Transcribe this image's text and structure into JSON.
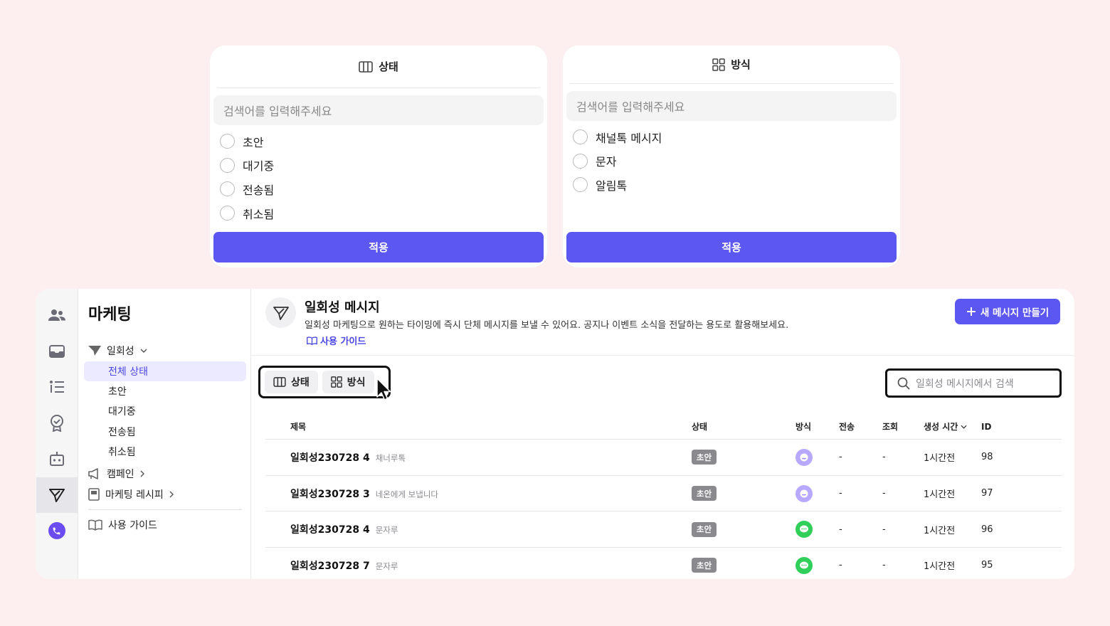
{
  "popover_status": {
    "title": "상태",
    "search_placeholder": "검색어를 입력해주세요",
    "options": [
      "초안",
      "대기중",
      "전송됨",
      "취소됨"
    ],
    "apply_label": "적용"
  },
  "popover_method": {
    "title": "방식",
    "search_placeholder": "검색어를 입력해주세요",
    "options": [
      "채널톡 메시지",
      "문자",
      "알림톡"
    ],
    "apply_label": "적용"
  },
  "sidenav": {
    "title": "마케팅",
    "group_onetime": "일회성",
    "items": [
      "전체 상태",
      "초안",
      "대기중",
      "전송됨",
      "취소됨"
    ],
    "campaign": "캠페인",
    "recipe": "마케팅 레시피",
    "guide": "사용 가이드"
  },
  "header": {
    "title": "일회성 메시지",
    "description": "일회성 마케팅으로 원하는 타이밍에 즉시 단체 메시지를 보낼 수 있어요. 공지나 이벤트 소식을 전달하는 용도로 활용해보세요.",
    "guide_link": "사용 가이드",
    "new_button": "새 메시지 만들기"
  },
  "filters": {
    "status": "상태",
    "method": "방식"
  },
  "search": {
    "placeholder": "일회성 메시지에서 검색"
  },
  "table": {
    "columns": {
      "title": "제목",
      "status": "상태",
      "method": "방식",
      "sent": "전송",
      "view": "조회",
      "created": "생성 시간",
      "id": "ID"
    },
    "rows": [
      {
        "title": "일회성230728 4",
        "sub": "채너루톡",
        "status": "초안",
        "method": "channel",
        "sent": "-",
        "view": "-",
        "created": "1시간전",
        "id": "98"
      },
      {
        "title": "일회성230728 3",
        "sub": "네온에게 보냅니다",
        "status": "초안",
        "method": "channel",
        "sent": "-",
        "view": "-",
        "created": "1시간전",
        "id": "97"
      },
      {
        "title": "일회성230728 4",
        "sub": "문자루",
        "status": "초안",
        "method": "sms",
        "sent": "-",
        "view": "-",
        "created": "1시간전",
        "id": "96"
      },
      {
        "title": "일회성230728 7",
        "sub": "문자루",
        "status": "초안",
        "method": "sms",
        "sent": "-",
        "view": "-",
        "created": "1시간전",
        "id": "95"
      }
    ]
  },
  "colors": {
    "accent": "#5b57f0",
    "background": "#fdeef0",
    "badge": "#8a8a8e",
    "channel_icon": "#b9a8ff",
    "sms_icon": "#2fcf5a"
  }
}
